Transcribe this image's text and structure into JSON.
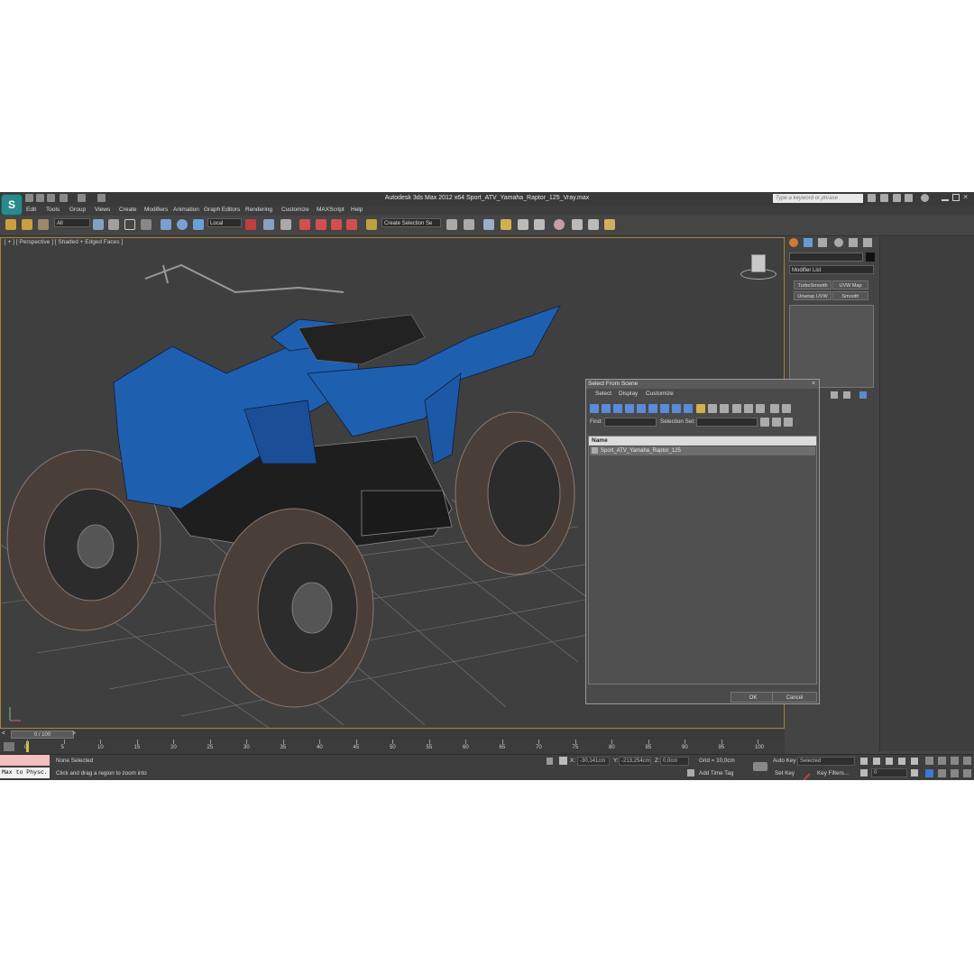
{
  "window": {
    "title": "Autodesk 3ds Max  2012 x64      Sport_ATV_Yamaha_Raptor_125_Vray.max",
    "search_placeholder": "Type a keyword or phrase"
  },
  "menu": [
    "Edit",
    "Tools",
    "Group",
    "Views",
    "Create",
    "Modifiers",
    "Animation",
    "Graph Editors",
    "Rendering",
    "Customize",
    "MAXScript",
    "Help"
  ],
  "toolbar": {
    "filter_value": "All",
    "coord_system": "Local",
    "selection_set_placeholder": "Create Selection Se"
  },
  "viewport": {
    "label": "[ + ] [ Perspective ] [ Shaded + Edged Faces ]",
    "object_colors": {
      "body": "#1f5fb0",
      "wire": "#1a1a1a",
      "tire": "#5a4a40"
    }
  },
  "command_panel": {
    "modifier_list": "Modifier List",
    "buttons": [
      "TurboSmooth",
      "UVW Map",
      "Unwrap UVW",
      "Smooth"
    ]
  },
  "dialog": {
    "title": "Select From Scene",
    "tabs": [
      "Select",
      "Display",
      "Customize"
    ],
    "find_label": "Find:",
    "selection_set_label": "Selection Set:",
    "column_name": "Name",
    "items": [
      "Sport_ATV_Yamaha_Raptor_125"
    ],
    "ok": "OK",
    "cancel": "Cancel"
  },
  "timeline": {
    "frame": "0 / 100",
    "ticks": [
      "0",
      "5",
      "10",
      "15",
      "20",
      "25",
      "30",
      "35",
      "40",
      "45",
      "50",
      "55",
      "60",
      "65",
      "70",
      "75",
      "80",
      "85",
      "90",
      "95",
      "100"
    ]
  },
  "status": {
    "script_listener": "Max to Physc.",
    "selection": "None Selected",
    "prompt": "Click and drag a region to zoom into",
    "x_label": "X:",
    "x_value": "-30,141cm",
    "y_label": "Y:",
    "y_value": "-213,254cm",
    "z_label": "Z:",
    "z_value": "0,0cm",
    "grid": "Grid = 10,0cm",
    "add_time_tag": "Add Time Tag",
    "auto_key": "Auto Key",
    "set_key": "Set Key",
    "key_mode_value": "Selected",
    "key_filters": "Key Filters...",
    "frame_value": "0"
  }
}
